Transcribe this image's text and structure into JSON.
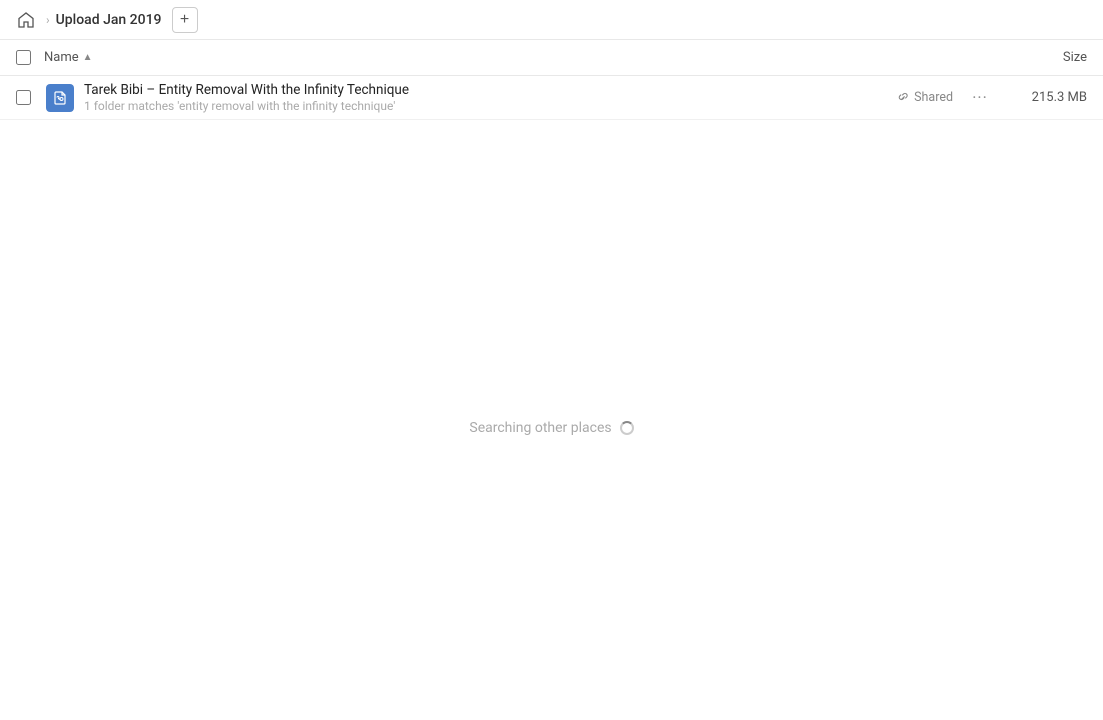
{
  "header": {
    "home_label": "Home",
    "breadcrumb_title": "Upload Jan 2019",
    "add_button_label": "+"
  },
  "table": {
    "col_name_label": "Name",
    "col_size_label": "Size",
    "sort_indicator": "▲"
  },
  "file_item": {
    "icon_label": "🔗",
    "name": "Tarek Bibi – Entity Removal With the Infinity Technique",
    "matches_text": "1 folder matches 'entity removal with the infinity technique'",
    "shared_label": "Shared",
    "more_label": "···",
    "size_main": "215.3 MB",
    "size_sub": "215.3 MB"
  },
  "searching": {
    "label": "Searching other places"
  }
}
